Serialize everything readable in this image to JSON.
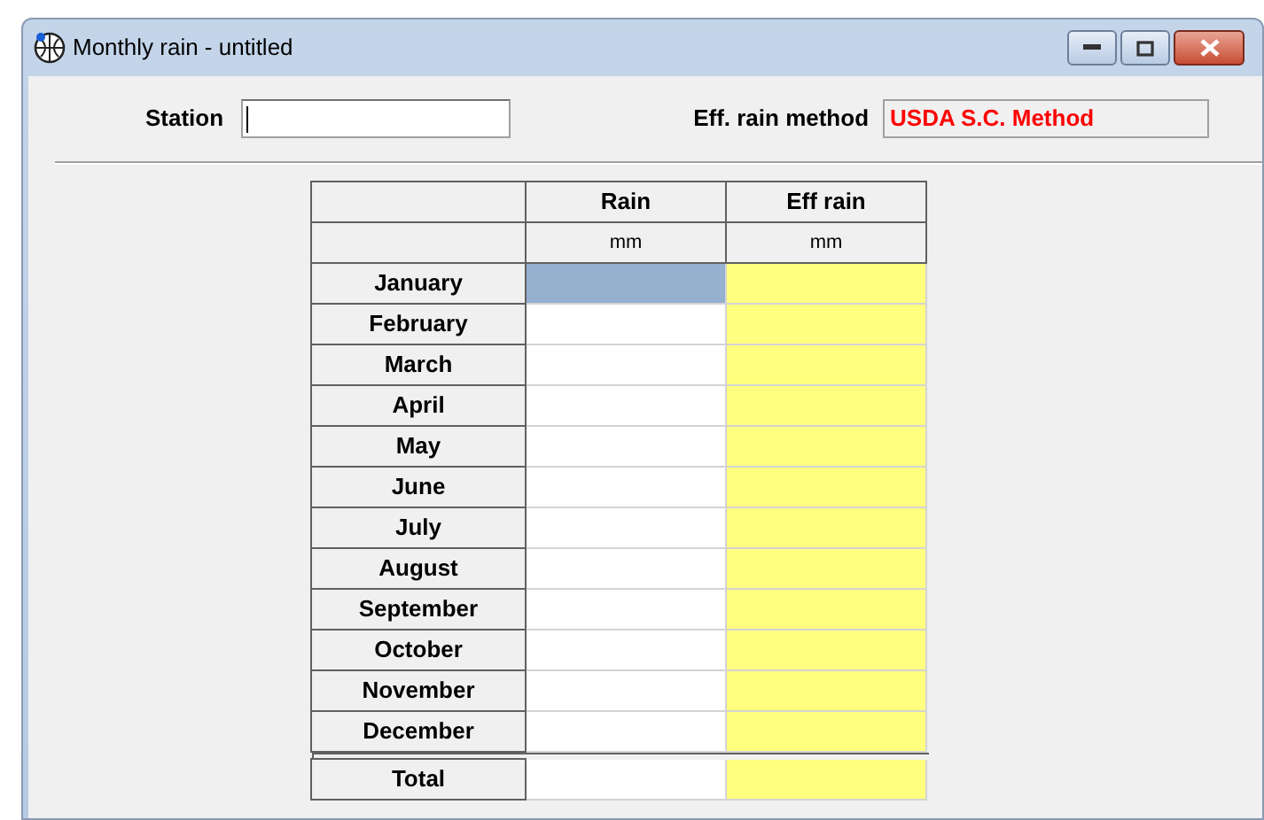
{
  "window": {
    "title": "Monthly rain - untitled"
  },
  "station": {
    "label": "Station",
    "focused": true
  },
  "eff_rain_method": {
    "label": "Eff. rain method",
    "value": "USDA S.C. Method"
  },
  "table": {
    "columns": [
      {
        "title": "Rain",
        "unit": "mm",
        "kind": "input"
      },
      {
        "title": "Eff rain",
        "unit": "mm",
        "kind": "computed"
      }
    ],
    "rows": [
      {
        "label": "January",
        "selected": true
      },
      {
        "label": "February",
        "selected": false
      },
      {
        "label": "March",
        "selected": false
      },
      {
        "label": "April",
        "selected": false
      },
      {
        "label": "May",
        "selected": false
      },
      {
        "label": "June",
        "selected": false
      },
      {
        "label": "July",
        "selected": false
      },
      {
        "label": "August",
        "selected": false
      },
      {
        "label": "September",
        "selected": false
      },
      {
        "label": "October",
        "selected": false
      },
      {
        "label": "November",
        "selected": false
      },
      {
        "label": "December",
        "selected": false
      }
    ],
    "total": {
      "label": "Total"
    }
  }
}
